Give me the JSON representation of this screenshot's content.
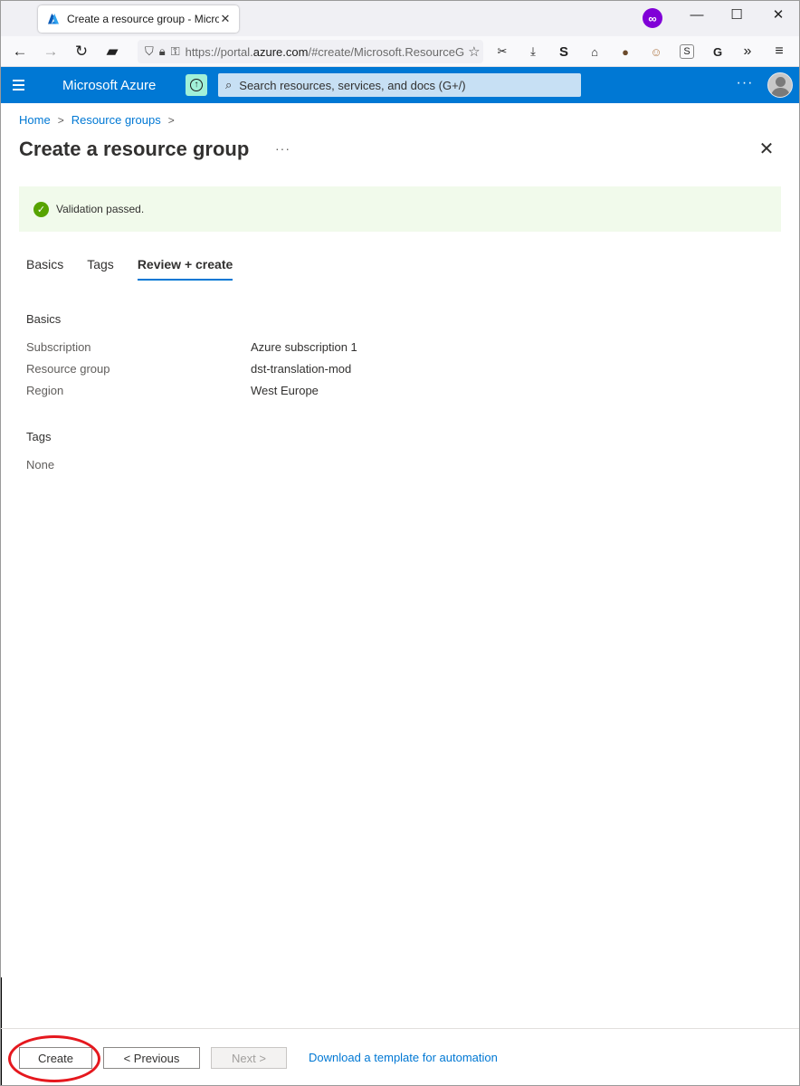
{
  "browser": {
    "tab_title": "Create a resource group - Microsoft Azure",
    "tab_close": "✕",
    "url_prefix": "https://portal.",
    "url_host": "azure.com",
    "url_path": "/#create/Microsoft.ResourceGroup",
    "icons": [
      "back-icon",
      "forward-icon",
      "reload-icon",
      "extension-icon",
      "shield-icon",
      "lock-icon",
      "key-icon",
      "star-icon",
      "screenshot-icon",
      "download-icon",
      "s-icon",
      "basket-icon",
      "cookie-icon",
      "monkey-icon",
      "s-square-icon",
      "g-icon",
      "overflow-icon",
      "menu-icon"
    ]
  },
  "azure": {
    "brand": "Microsoft Azure",
    "search_placeholder": "Search resources, services, and docs (G+/)",
    "more": "···",
    "accent": "#0078d4"
  },
  "breadcrumb": {
    "items": [
      "Home",
      "Resource groups"
    ],
    "separator": ">"
  },
  "page": {
    "title": "Create a resource group",
    "more": "···",
    "close": "✕"
  },
  "banner": {
    "text": "Validation passed.",
    "color": "#57a300"
  },
  "tabs": [
    "Basics",
    "Tags",
    "Review + create"
  ],
  "active_tab": "Review + create",
  "review": {
    "basics_heading": "Basics",
    "rows": [
      {
        "label": "Subscription",
        "value": "Azure subscription 1"
      },
      {
        "label": "Resource group",
        "value": "dst-translation-mod"
      },
      {
        "label": "Region",
        "value": "West Europe"
      }
    ],
    "tags_heading": "Tags",
    "tags_value": "None"
  },
  "footer": {
    "create": "Create",
    "previous": "< Previous",
    "next": "Next >",
    "download_link": "Download a template for automation",
    "highlight_color": "#e5181e"
  }
}
